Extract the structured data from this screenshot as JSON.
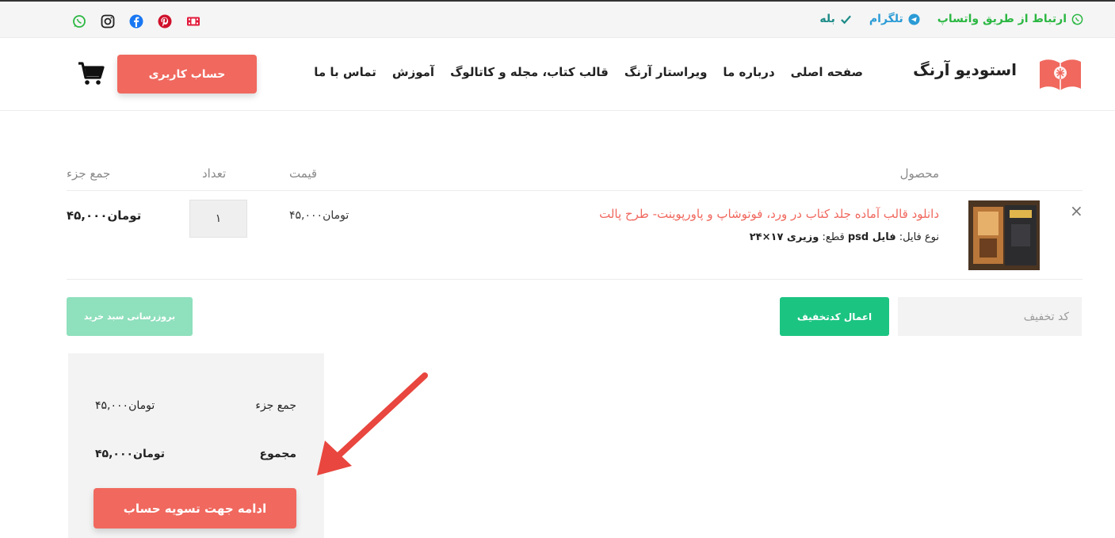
{
  "topbar": {
    "whatsapp_label": "ارتباط از طریق واتساپ",
    "telegram_label": "تلگرام",
    "yes_label": "بله",
    "social_icons": [
      "whatsapp-icon",
      "instagram-icon",
      "facebook-icon",
      "pinterest-icon",
      "aparat-icon"
    ]
  },
  "header": {
    "site_title": "استودیو آرنگ",
    "menu": [
      "صفحه اصلی",
      "درباره ما",
      "ویراستار آرنگ",
      "قالب کتاب، مجله و کاتالوگ",
      "آموزش",
      "تماس با ما"
    ],
    "account_button": "حساب کاربری"
  },
  "cart": {
    "headers": {
      "product": "محصول",
      "price": "قیمت",
      "quantity": "تعداد",
      "subtotal": "جمع جزء"
    },
    "item": {
      "title": "دانلود قالب آماده جلد کتاب در ورد، فوتوشاپ و پاورپوینت- طرح پالت",
      "file_type_label": "نوع فایل:",
      "file_type_value": "فایل psd",
      "size_label": "قطع:",
      "size_value": "وزیری ۱۷×۲۴",
      "price": "۴۵,۰۰۰تومان",
      "quantity": "۱",
      "subtotal": "۴۵,۰۰۰تومان",
      "remove_symbol": "×"
    },
    "coupon_placeholder": "کد تخفیف",
    "apply_coupon": "اعمال کدتخفیف",
    "update_cart": "بروزرسانی سبد خرید"
  },
  "totals": {
    "subtotal_label": "جمع جزء",
    "subtotal_value": "۴۵,۰۰۰تومان",
    "total_label": "مجموع",
    "total_value": "۴۵,۰۰۰تومان",
    "checkout_button": "ادامه جهت تسویه حساب"
  },
  "colors": {
    "accent": "#f0685e",
    "green": "#1cc482",
    "green_light": "#8fe0bd",
    "whatsapp": "#2bb742",
    "telegram": "#2a9bd6",
    "arrow": "#e8463e"
  }
}
